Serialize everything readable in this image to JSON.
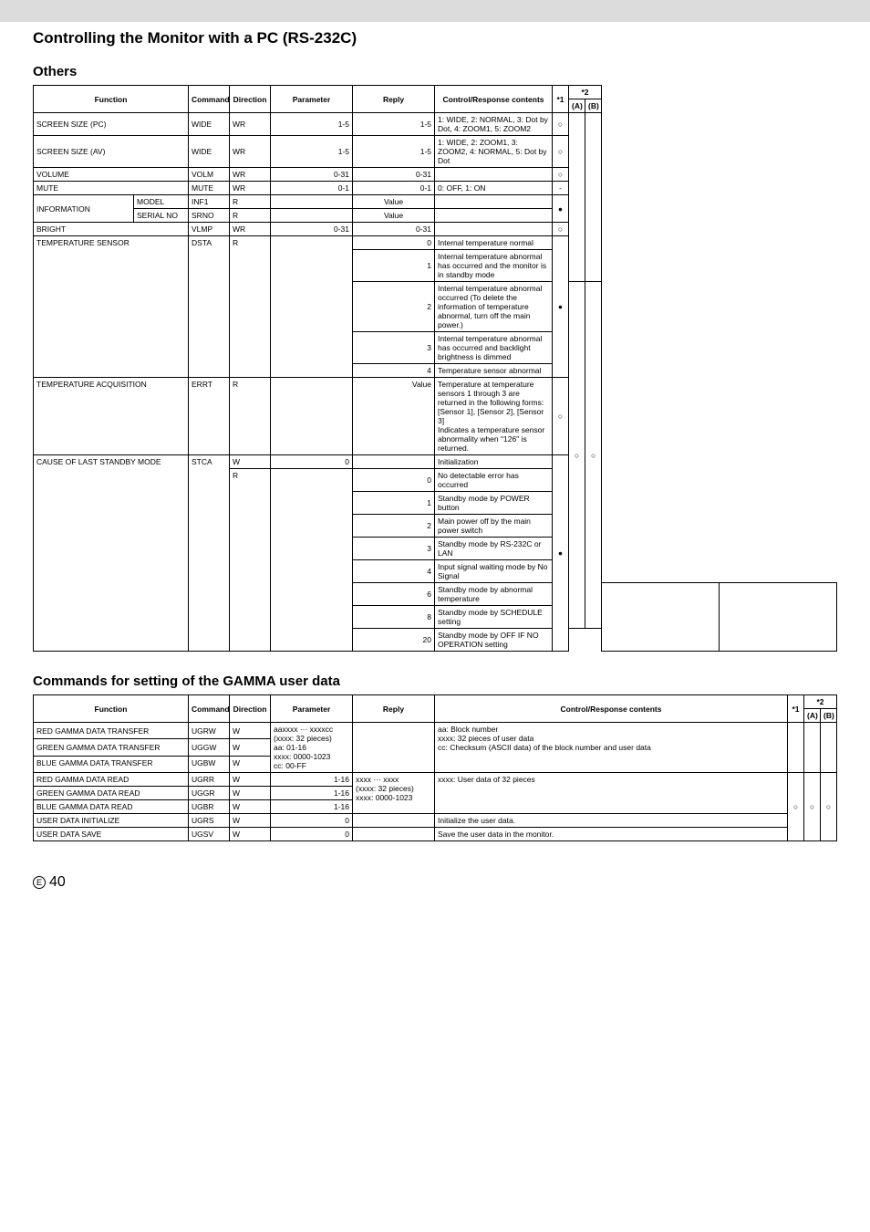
{
  "page": {
    "title": "Controlling the Monitor with a PC (RS-232C)",
    "number": "40",
    "e_marker": "E"
  },
  "others": {
    "title": "Others",
    "headers": {
      "function": "Function",
      "command": "Command",
      "direction": "Direction",
      "parameter": "Parameter",
      "reply": "Reply",
      "contents": "Control/Response contents",
      "star1": "*1",
      "star2": "*2",
      "a": "(A)",
      "b": "(B)"
    },
    "rows": {
      "screen_pc": {
        "func": "SCREEN SIZE (PC)",
        "cmd": "WIDE",
        "dir": "WR",
        "par": "1-5",
        "rep": "1-5",
        "cont": "1: WIDE, 2: NORMAL, 3: Dot by Dot, 4: ZOOM1, 5: ZOOM2",
        "s1": "○"
      },
      "screen_av": {
        "func": "SCREEN SIZE (AV)",
        "cmd": "WIDE",
        "dir": "WR",
        "par": "1-5",
        "rep": "1-5",
        "cont": "1: WIDE, 2: ZOOM1, 3: ZOOM2, 4: NORMAL, 5: Dot by Dot",
        "s1": "○"
      },
      "volume": {
        "func": "VOLUME",
        "cmd": "VOLM",
        "dir": "WR",
        "par": "0-31",
        "rep": "0-31",
        "cont": "",
        "s1": "○"
      },
      "mute": {
        "func": "MUTE",
        "cmd": "MUTE",
        "dir": "WR",
        "par": "0-1",
        "rep": "0-1",
        "cont": "0: OFF, 1: ON",
        "s1": "-"
      },
      "info": {
        "label": "INFORMATION",
        "model": {
          "sub": "MODEL",
          "cmd": "INF1",
          "dir": "R",
          "par": "",
          "rep": "Value",
          "cont": ""
        },
        "serial": {
          "sub": "SERIAL NO",
          "cmd": "SRNO",
          "dir": "R",
          "par": "",
          "rep": "Value",
          "cont": ""
        },
        "s1": "●"
      },
      "bright": {
        "func": "BRIGHT",
        "cmd": "VLMP",
        "dir": "WR",
        "par": "0-31",
        "rep": "0-31",
        "cont": "",
        "s1": "○"
      },
      "temp_sensor": {
        "func": "TEMPERATURE SENSOR",
        "cmd": "DSTA",
        "dir": "R",
        "r0": {
          "rep": "0",
          "cont": "Internal temperature normal"
        },
        "r1": {
          "rep": "1",
          "cont": "Internal temperature abnormal has occurred and the monitor is in standby mode"
        },
        "r2": {
          "rep": "2",
          "cont": "Internal temperature abnormal occurred (To delete the information of temperature abnormal, turn off the main power.)"
        },
        "r3": {
          "rep": "3",
          "cont": "Internal temperature abnormal has occurred and backlight brightness is dimmed"
        },
        "r4": {
          "rep": "4",
          "cont": "Temperature sensor abnormal"
        },
        "s1": "●",
        "sa": "○",
        "sb": "○"
      },
      "temp_acq": {
        "func": "TEMPERATURE ACQUISITION",
        "cmd": "ERRT",
        "dir": "R",
        "rep": "Value",
        "cont": "Temperature at temperature sensors 1 through 3 are returned in the following forms:\n[Sensor 1], [Sensor 2], [Sensor 3]\nIndicates a temperature sensor abnormality when \"126\" is returned.",
        "s1": "○"
      },
      "last_standby": {
        "func": "CAUSE OF LAST STANDBY MODE",
        "cmd": "STCA",
        "w": {
          "dir": "W",
          "par": "0",
          "cont": "Initialization"
        },
        "r0": {
          "dir": "R",
          "rep": "0",
          "cont": "No detectable error has occurred"
        },
        "r1": {
          "rep": "1",
          "cont": "Standby mode by POWER button"
        },
        "r2": {
          "rep": "2",
          "cont": "Main power off by the main power switch"
        },
        "r3": {
          "rep": "3",
          "cont": "Standby mode by RS-232C or LAN"
        },
        "r4": {
          "rep": "4",
          "cont": "Input signal waiting mode by No Signal"
        },
        "r6": {
          "rep": "6",
          "cont": "Standby mode by abnormal temperature"
        },
        "r8": {
          "rep": "8",
          "cont": "Standby mode by SCHEDULE setting"
        },
        "r20": {
          "rep": "20",
          "cont": "Standby mode by OFF IF NO OPERATION setting"
        },
        "s1": "●"
      }
    }
  },
  "gamma": {
    "title": "Commands for setting of the GAMMA user data",
    "headers": {
      "function": "Function",
      "command": "Command",
      "direction": "Direction",
      "parameter": "Parameter",
      "reply": "Reply",
      "contents": "Control/Response contents",
      "star1": "*1",
      "star2": "*2",
      "a": "(A)",
      "b": "(B)"
    },
    "rows": {
      "xfer": {
        "red": {
          "func": "RED GAMMA DATA TRANSFER",
          "cmd": "UGRW",
          "dir": "W"
        },
        "green": {
          "func": "GREEN GAMMA DATA TRANSFER",
          "cmd": "UGGW",
          "dir": "W"
        },
        "blue": {
          "func": "BLUE GAMMA DATA TRANSFER",
          "cmd": "UGBW",
          "dir": "W"
        },
        "par": "aaxxxx ··· xxxxcc\n(xxxx: 32 pieces)\naa: 01-16\nxxxx: 0000-1023\ncc: 00-FF",
        "cont": "aa: Block number\nxxxx: 32 pieces of user data\ncc: Checksum (ASCII data) of the block number and user data"
      },
      "read": {
        "red": {
          "func": "RED GAMMA DATA READ",
          "cmd": "UGRR",
          "dir": "W",
          "par": "1-16"
        },
        "green": {
          "func": "GREEN GAMMA DATA READ",
          "cmd": "UGGR",
          "dir": "W",
          "par": "1-16"
        },
        "blue": {
          "func": "BLUE GAMMA DATA READ",
          "cmd": "UGBR",
          "dir": "W",
          "par": "1-16"
        },
        "rep": "xxxx ··· xxxx\n(xxxx: 32 pieces)\nxxxx: 0000-1023",
        "cont": "xxxx: User data of 32 pieces",
        "s1": "○",
        "sa": "○",
        "sb": "○"
      },
      "init": {
        "func": "USER DATA INITIALIZE",
        "cmd": "UGRS",
        "dir": "W",
        "par": "0",
        "cont": "Initialize the user data."
      },
      "save": {
        "func": "USER DATA SAVE",
        "cmd": "UGSV",
        "dir": "W",
        "par": "0",
        "cont": "Save the user data in the monitor."
      }
    }
  }
}
